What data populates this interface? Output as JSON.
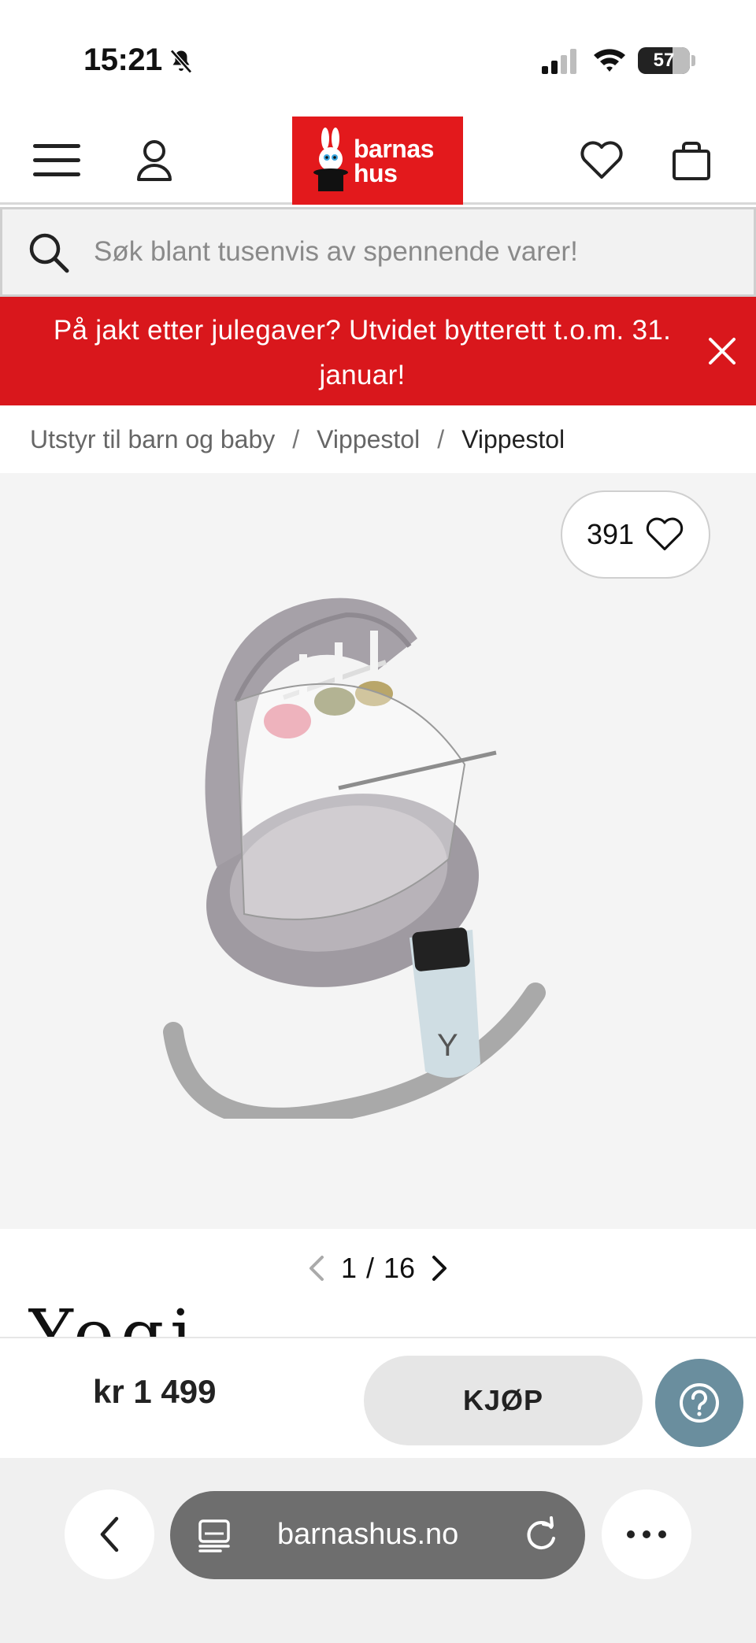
{
  "status_bar": {
    "time": "15:21",
    "battery": "57"
  },
  "header": {
    "logo_line1": "barnas",
    "logo_line2": "hus",
    "colors": {
      "brand_red": "#e3191c",
      "promo_red": "#d9171c",
      "help_blue": "#6a8e9e"
    }
  },
  "search": {
    "placeholder": "Søk blant tusenvis av spennende varer!",
    "value": ""
  },
  "promo": {
    "text": "På jakt etter julegaver? Utvidet bytterett t.o.m. 31. januar!"
  },
  "breadcrumb": {
    "items": [
      "Utstyr til barn og baby",
      "Vippestol",
      "Vippestol"
    ],
    "separator": "/"
  },
  "gallery": {
    "favorite_count": "391",
    "current_index": "1",
    "total": "16",
    "separator": "/"
  },
  "brand_peek": "Yogi",
  "buy_bar": {
    "price": "kr 1 499",
    "buy_label": "KJØP"
  },
  "browser": {
    "url": "barnashus.no"
  },
  "icons": [
    "bell-slash-icon",
    "signal-icon",
    "wifi-icon",
    "battery-icon",
    "menu-icon",
    "user-icon",
    "heart-icon",
    "bag-icon",
    "search-icon",
    "close-icon",
    "chevron-left-icon",
    "chevron-right-icon",
    "help-icon",
    "back-icon",
    "tabs-icon",
    "reload-icon",
    "more-icon"
  ]
}
